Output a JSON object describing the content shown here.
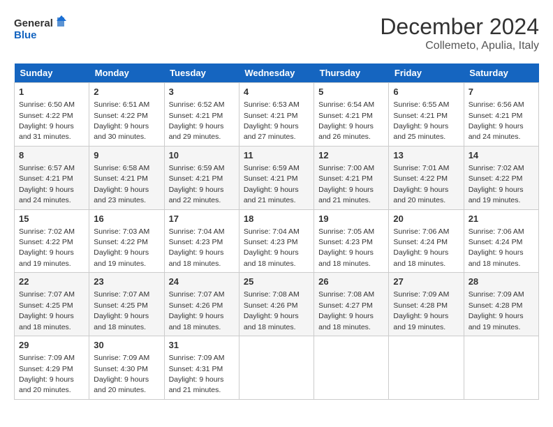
{
  "header": {
    "logo_line1": "General",
    "logo_line2": "Blue",
    "month_title": "December 2024",
    "location": "Collemeto, Apulia, Italy"
  },
  "days_of_week": [
    "Sunday",
    "Monday",
    "Tuesday",
    "Wednesday",
    "Thursday",
    "Friday",
    "Saturday"
  ],
  "weeks": [
    [
      {
        "day": 1,
        "sunrise": "6:50 AM",
        "sunset": "4:22 PM",
        "daylight": "9 hours and 31 minutes."
      },
      {
        "day": 2,
        "sunrise": "6:51 AM",
        "sunset": "4:22 PM",
        "daylight": "9 hours and 30 minutes."
      },
      {
        "day": 3,
        "sunrise": "6:52 AM",
        "sunset": "4:21 PM",
        "daylight": "9 hours and 29 minutes."
      },
      {
        "day": 4,
        "sunrise": "6:53 AM",
        "sunset": "4:21 PM",
        "daylight": "9 hours and 27 minutes."
      },
      {
        "day": 5,
        "sunrise": "6:54 AM",
        "sunset": "4:21 PM",
        "daylight": "9 hours and 26 minutes."
      },
      {
        "day": 6,
        "sunrise": "6:55 AM",
        "sunset": "4:21 PM",
        "daylight": "9 hours and 25 minutes."
      },
      {
        "day": 7,
        "sunrise": "6:56 AM",
        "sunset": "4:21 PM",
        "daylight": "9 hours and 24 minutes."
      }
    ],
    [
      {
        "day": 8,
        "sunrise": "6:57 AM",
        "sunset": "4:21 PM",
        "daylight": "9 hours and 24 minutes."
      },
      {
        "day": 9,
        "sunrise": "6:58 AM",
        "sunset": "4:21 PM",
        "daylight": "9 hours and 23 minutes."
      },
      {
        "day": 10,
        "sunrise": "6:59 AM",
        "sunset": "4:21 PM",
        "daylight": "9 hours and 22 minutes."
      },
      {
        "day": 11,
        "sunrise": "6:59 AM",
        "sunset": "4:21 PM",
        "daylight": "9 hours and 21 minutes."
      },
      {
        "day": 12,
        "sunrise": "7:00 AM",
        "sunset": "4:21 PM",
        "daylight": "9 hours and 21 minutes."
      },
      {
        "day": 13,
        "sunrise": "7:01 AM",
        "sunset": "4:22 PM",
        "daylight": "9 hours and 20 minutes."
      },
      {
        "day": 14,
        "sunrise": "7:02 AM",
        "sunset": "4:22 PM",
        "daylight": "9 hours and 19 minutes."
      }
    ],
    [
      {
        "day": 15,
        "sunrise": "7:02 AM",
        "sunset": "4:22 PM",
        "daylight": "9 hours and 19 minutes."
      },
      {
        "day": 16,
        "sunrise": "7:03 AM",
        "sunset": "4:22 PM",
        "daylight": "9 hours and 19 minutes."
      },
      {
        "day": 17,
        "sunrise": "7:04 AM",
        "sunset": "4:23 PM",
        "daylight": "9 hours and 18 minutes."
      },
      {
        "day": 18,
        "sunrise": "7:04 AM",
        "sunset": "4:23 PM",
        "daylight": "9 hours and 18 minutes."
      },
      {
        "day": 19,
        "sunrise": "7:05 AM",
        "sunset": "4:23 PM",
        "daylight": "9 hours and 18 minutes."
      },
      {
        "day": 20,
        "sunrise": "7:06 AM",
        "sunset": "4:24 PM",
        "daylight": "9 hours and 18 minutes."
      },
      {
        "day": 21,
        "sunrise": "7:06 AM",
        "sunset": "4:24 PM",
        "daylight": "9 hours and 18 minutes."
      }
    ],
    [
      {
        "day": 22,
        "sunrise": "7:07 AM",
        "sunset": "4:25 PM",
        "daylight": "9 hours and 18 minutes."
      },
      {
        "day": 23,
        "sunrise": "7:07 AM",
        "sunset": "4:25 PM",
        "daylight": "9 hours and 18 minutes."
      },
      {
        "day": 24,
        "sunrise": "7:07 AM",
        "sunset": "4:26 PM",
        "daylight": "9 hours and 18 minutes."
      },
      {
        "day": 25,
        "sunrise": "7:08 AM",
        "sunset": "4:26 PM",
        "daylight": "9 hours and 18 minutes."
      },
      {
        "day": 26,
        "sunrise": "7:08 AM",
        "sunset": "4:27 PM",
        "daylight": "9 hours and 18 minutes."
      },
      {
        "day": 27,
        "sunrise": "7:09 AM",
        "sunset": "4:28 PM",
        "daylight": "9 hours and 19 minutes."
      },
      {
        "day": 28,
        "sunrise": "7:09 AM",
        "sunset": "4:28 PM",
        "daylight": "9 hours and 19 minutes."
      }
    ],
    [
      {
        "day": 29,
        "sunrise": "7:09 AM",
        "sunset": "4:29 PM",
        "daylight": "9 hours and 20 minutes."
      },
      {
        "day": 30,
        "sunrise": "7:09 AM",
        "sunset": "4:30 PM",
        "daylight": "9 hours and 20 minutes."
      },
      {
        "day": 31,
        "sunrise": "7:09 AM",
        "sunset": "4:31 PM",
        "daylight": "9 hours and 21 minutes."
      },
      null,
      null,
      null,
      null
    ]
  ]
}
